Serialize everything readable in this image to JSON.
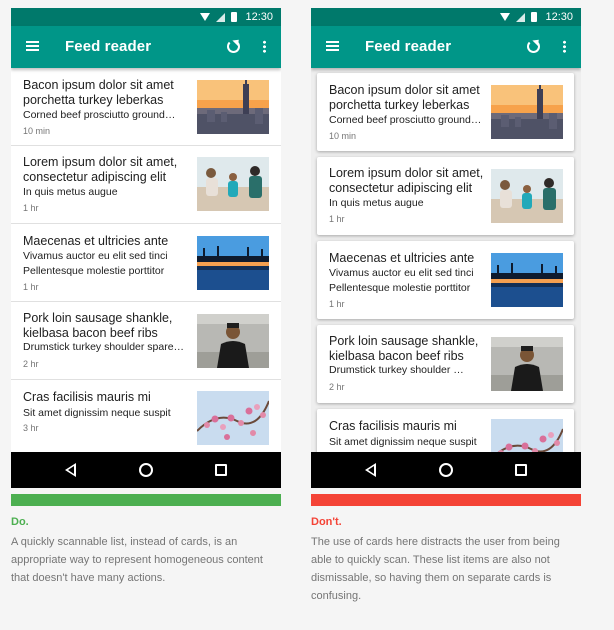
{
  "status": {
    "time": "12:30"
  },
  "appbar": {
    "title": "Feed reader"
  },
  "items": [
    {
      "title": "Bacon ipsum dolor sit amet porchetta turkey leberkas",
      "subtitle": "Corned beef prosciutto ground…",
      "time": "10 min",
      "image": "city-skyline-sunset"
    },
    {
      "title": "Lorem ipsum dolor sit amet, consectetur adipiscing elit",
      "subtitle": "In quis metus augue",
      "time": "1 hr",
      "image": "family-on-beach"
    },
    {
      "title": "Maecenas et ultricies ante",
      "subtitle": "Vivamus auctor eu elit sed tinci",
      "subtitle2": "Pellentesque molestie porttitor",
      "time": "1 hr",
      "image": "palm-trees-reflection"
    },
    {
      "title": "Pork loin sausage shankle, kielbasa bacon beef ribs",
      "subtitle": "Drumstick turkey shoulder spare…",
      "subtitle_card": "Drumstick turkey shoulder …",
      "time": "2 hr",
      "image": "man-portrait"
    },
    {
      "title": "Cras facilisis mauris mi",
      "subtitle": "Sit amet dignissim neque suspit",
      "time": "3 hr",
      "image": "pink-blossoms"
    }
  ],
  "do": {
    "label": "Do.",
    "description": "A quickly scannable list, instead of cards, is an appropriate way to represent homogeneous content that doesn't have many actions.",
    "color": "#4caf50"
  },
  "dont": {
    "label": "Don't.",
    "description": "The use of cards here distracts the user from being able to quickly scan. These list items are also not dismissable, so having them on separate cards is confusing.",
    "color": "#f44336"
  },
  "colors": {
    "primary": "#009688",
    "primary_dark": "#00796b"
  }
}
